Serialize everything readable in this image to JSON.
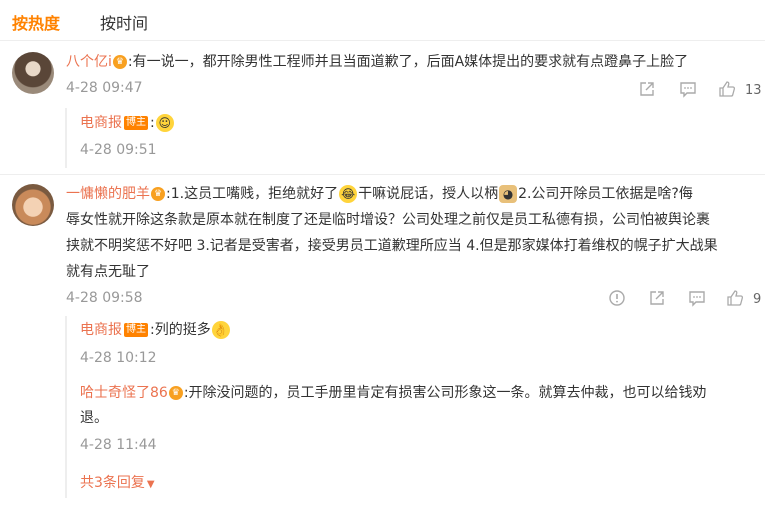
{
  "tabs": {
    "hot": "按热度",
    "time": "按时间"
  },
  "comments": [
    {
      "user": "八个亿i",
      "text": ":有一说一，都开除男性工程师并且当面道歉了，后面A媒体提出的要求就有点蹬鼻子上脸了",
      "time": "4-28 09:47",
      "likes": "13",
      "replies": [
        {
          "user": "电商报",
          "badge": "博主",
          "text": ":",
          "time": "4-28 09:51"
        }
      ]
    },
    {
      "user": "一慵懒的肥羊",
      "line1a": ":1.这员工嘴贱，拒绝就好了",
      "line1b": "干嘛说屁话，授人以柄",
      "line1c": "2.公司开除员工依据是啥?侮",
      "line2": "辱女性就开除这条款是原本就在制度了还是临时增设？公司处理之前仅是员工私德有损，公司怕被舆论裹",
      "line3": "挟就不明奖惩不好吧 3.记者是受害者，接受男员工道歉理所应当 4.但是那家媒体打着维权的幌子扩大战果",
      "line4": "就有点无耻了",
      "time": "4-28 09:58",
      "likes": "9",
      "replies": [
        {
          "user": "电商报",
          "badge": "博主",
          "text": ":列的挺多",
          "time": "4-28 10:12"
        },
        {
          "user": "哈士奇怪了86",
          "text1": ":开除没问题的，员工手册里肯定有损害公司形象这一条。就算去仲裁，也可以给钱劝",
          "text2": "退。",
          "time": "4-28 11:44"
        }
      ],
      "more": "共3条回复"
    }
  ],
  "icons": {
    "vip": "vip-crown-icon",
    "share": "share-icon",
    "comment": "comment-icon",
    "like": "thumbs-up-icon",
    "report": "report-icon"
  }
}
